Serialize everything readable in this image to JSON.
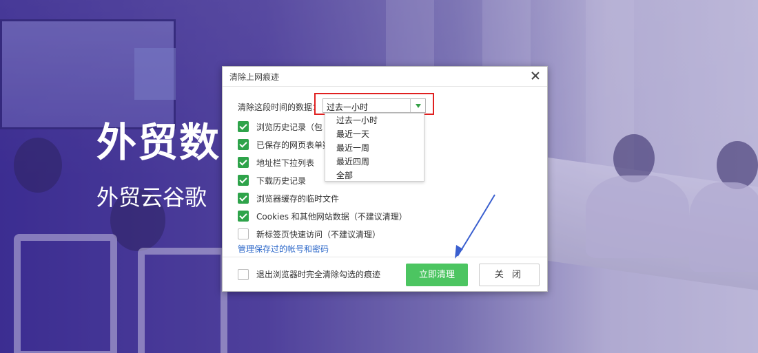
{
  "hero": {
    "title": "外贸数",
    "subtitle": "外贸云谷歌"
  },
  "dialog": {
    "title": "清除上网痕迹",
    "range_label": "清除这段时间的数据：",
    "range_selected": "过去一小时",
    "range_options": [
      "过去一小时",
      "最近一天",
      "最近一周",
      "最近四周",
      "全部"
    ],
    "items": [
      {
        "label": "浏览历史记录（包",
        "checked": true
      },
      {
        "label": "已保存的网页表单数",
        "checked": true
      },
      {
        "label": "地址栏下拉列表",
        "checked": true
      },
      {
        "label": "下载历史记录",
        "checked": true
      },
      {
        "label": "浏览器缓存的临时文件",
        "checked": true
      },
      {
        "label": "Cookies 和其他网站数据（不建议清理）",
        "checked": true
      },
      {
        "label": "新标签页快速访问（不建议清理）",
        "checked": false
      }
    ],
    "manage_link": "管理保存过的帐号和密码",
    "footer_option": {
      "label": "退出浏览器时完全清除勾选的痕迹",
      "checked": false
    },
    "clear_button": "立即清理",
    "close_button": "关 闭"
  },
  "colors": {
    "accent_green": "#4cc561",
    "checkbox_green": "#2ea34a",
    "link_blue": "#2b67c9",
    "highlight_red": "#e02020",
    "annotation_arrow": "#3a5fcf"
  }
}
